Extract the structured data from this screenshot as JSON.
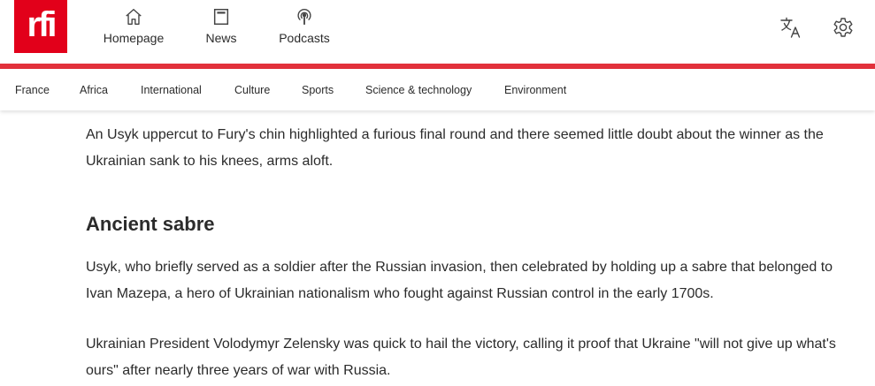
{
  "brand": {
    "logo_text": "rfi",
    "color": "#e2001a"
  },
  "nav": {
    "items": [
      {
        "label": "Homepage",
        "icon": "home-icon"
      },
      {
        "label": "News",
        "icon": "newspaper-icon"
      },
      {
        "label": "Podcasts",
        "icon": "podcast-icon"
      }
    ]
  },
  "tools": {
    "language_icon": "translate-icon",
    "settings_icon": "gear-icon"
  },
  "subnav": {
    "items": [
      "France",
      "Africa",
      "International",
      "Culture",
      "Sports",
      "Science & technology",
      "Environment"
    ]
  },
  "article": {
    "para1": "An Usyk uppercut to Fury's chin highlighted a furious final round and there seemed little doubt about the winner as the Ukrainian sank to his knees, arms aloft.",
    "heading": "Ancient sabre",
    "para2": "Usyk, who briefly served as a soldier after the Russian invasion, then celebrated by holding up a sabre that belonged to Ivan Mazepa, a hero of Ukrainian nationalism who fought against Russian control in the early 1700s.",
    "para3": "Ukrainian President Volodymyr Zelensky was quick to hail the victory, calling it proof that Ukraine \"will not give up what's ours\" after nearly three years of war with Russia."
  },
  "colors": {
    "accent_red": "#e2313b",
    "text": "#2b2b2b"
  }
}
